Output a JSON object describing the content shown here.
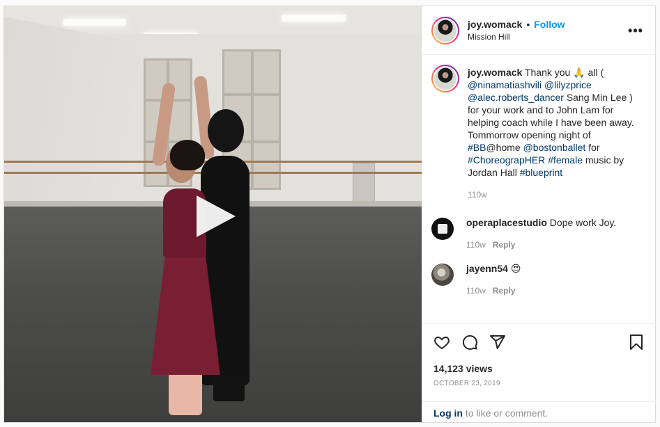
{
  "post": {
    "username": "joy.womack",
    "separator": "•",
    "follow_label": "Follow",
    "location": "Mission Hill",
    "more_icon": "more-horizontal-icon"
  },
  "media": {
    "type": "video",
    "play_icon": "play-icon"
  },
  "caption": {
    "username": "joy.womack",
    "segments": [
      {
        "text": " Thank you 🙏 all ( ",
        "tag": false
      },
      {
        "text": "@ninamatiashvili",
        "tag": true
      },
      {
        "text": " ",
        "tag": false
      },
      {
        "text": "@lilyzprice",
        "tag": true
      },
      {
        "text": " ",
        "tag": false
      },
      {
        "text": "@alec.roberts_dancer",
        "tag": true
      },
      {
        "text": " Sang Min Lee ) for your work and to John Lam for helping coach while I have been away. Tommorrow opening night of ",
        "tag": false
      },
      {
        "text": "#BB",
        "tag": true
      },
      {
        "text": "@home ",
        "tag": false
      },
      {
        "text": "@bostonballet",
        "tag": true
      },
      {
        "text": " for ",
        "tag": false
      },
      {
        "text": "#ChoreograpHER",
        "tag": true
      },
      {
        "text": " ",
        "tag": false
      },
      {
        "text": "#female",
        "tag": true
      },
      {
        "text": " music by Jordan Hall ",
        "tag": false
      },
      {
        "text": "#blueprint",
        "tag": true
      }
    ],
    "age": "110w"
  },
  "comments": [
    {
      "username": "operaplacestudio",
      "text": " Dope work Joy.",
      "age": "110w",
      "reply_label": "Reply"
    },
    {
      "username": "jayenn54",
      "text": " 😍",
      "age": "110w",
      "reply_label": "Reply"
    }
  ],
  "actions": {
    "like_icon": "heart-icon",
    "comment_icon": "comment-icon",
    "share_icon": "share-icon",
    "save_icon": "bookmark-icon"
  },
  "stats": {
    "views": "14,123 views",
    "date": "OCTOBER 23, 2019"
  },
  "footer": {
    "login_label": "Log in",
    "rest": " to like or comment."
  }
}
